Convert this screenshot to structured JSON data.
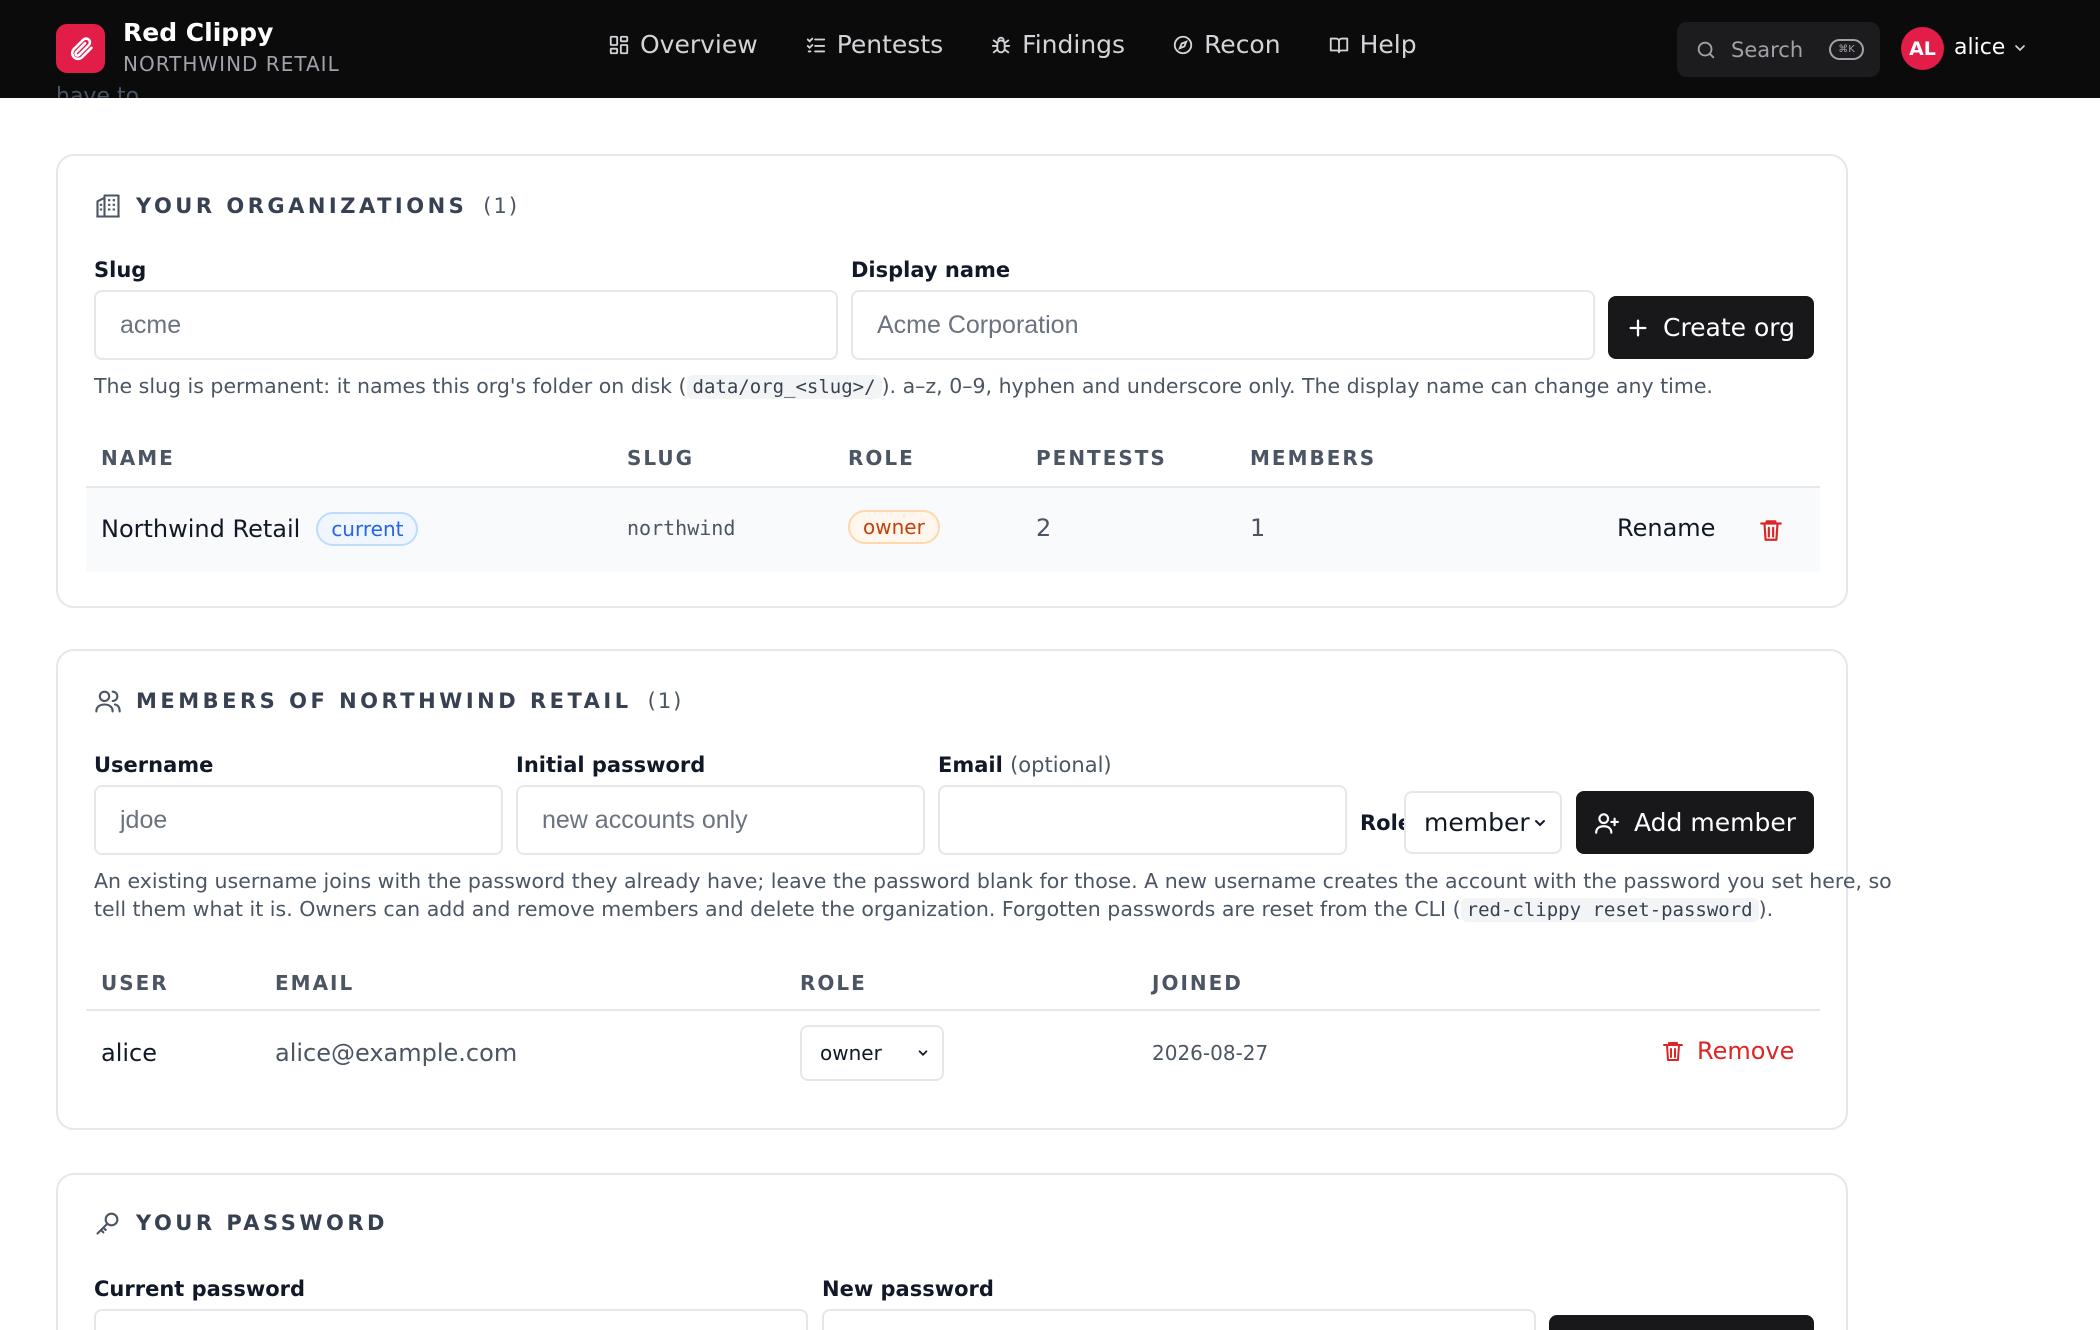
{
  "app": {
    "name": "Red Clippy",
    "org": "NORTHWIND RETAIL"
  },
  "nav": [
    {
      "label": "Overview",
      "icon": "dashboard-icon"
    },
    {
      "label": "Pentests",
      "icon": "checklist-icon"
    },
    {
      "label": "Findings",
      "icon": "bug-icon"
    },
    {
      "label": "Recon",
      "icon": "compass-icon"
    },
    {
      "label": "Help",
      "icon": "book-icon"
    }
  ],
  "search": {
    "label": "Search",
    "shortcut": "⌘K"
  },
  "user": {
    "initials": "AL",
    "name": "alice"
  },
  "cut_text": "have to.",
  "orgs": {
    "title": "YOUR ORGANIZATIONS",
    "count": "(1)",
    "slug_label": "Slug",
    "slug_placeholder": "acme",
    "display_label": "Display name",
    "display_placeholder": "Acme Corporation",
    "create_label": "Create org",
    "help_pre": "The slug is permanent: it names this org's folder on disk (",
    "help_code": "data/org_<slug>/",
    "help_post": "). a–z, 0–9, hyphen and underscore only. The display name can change any time.",
    "columns": [
      "NAME",
      "SLUG",
      "ROLE",
      "PENTESTS",
      "MEMBERS"
    ],
    "rows": [
      {
        "name": "Northwind Retail",
        "badge": "current",
        "slug": "northwind",
        "role": "owner",
        "pentests": "2",
        "members": "1",
        "rename": "Rename"
      }
    ]
  },
  "members": {
    "title": "MEMBERS OF NORTHWIND RETAIL",
    "count": "(1)",
    "username_label": "Username",
    "username_placeholder": "jdoe",
    "password_label": "Initial password",
    "password_placeholder": "new accounts only",
    "email_label": "Email",
    "email_optional": "(optional)",
    "email_value": "",
    "role_label": "Role",
    "role_value": "member",
    "add_label": "Add member",
    "help_line1": "An existing username joins with the password they already have; leave the password blank for those. A new username creates the account with the password you set here, so",
    "help_line2_pre": "tell them what it is. Owners can add and remove members and delete the organization. Forgotten passwords are reset from the CLI (",
    "help_code": "red-clippy reset-password",
    "help_line2_post": ").",
    "columns": [
      "USER",
      "EMAIL",
      "ROLE",
      "JOINED"
    ],
    "rows": [
      {
        "user": "alice",
        "email": "alice@example.com",
        "role": "owner",
        "joined": "2026-08-27",
        "remove": "Remove"
      }
    ]
  },
  "password": {
    "title": "YOUR PASSWORD",
    "current_label": "Current password",
    "new_label": "New password"
  },
  "colors": {
    "accent": "#e11d48",
    "danger": "#dc2626",
    "dark": "#18181b"
  }
}
